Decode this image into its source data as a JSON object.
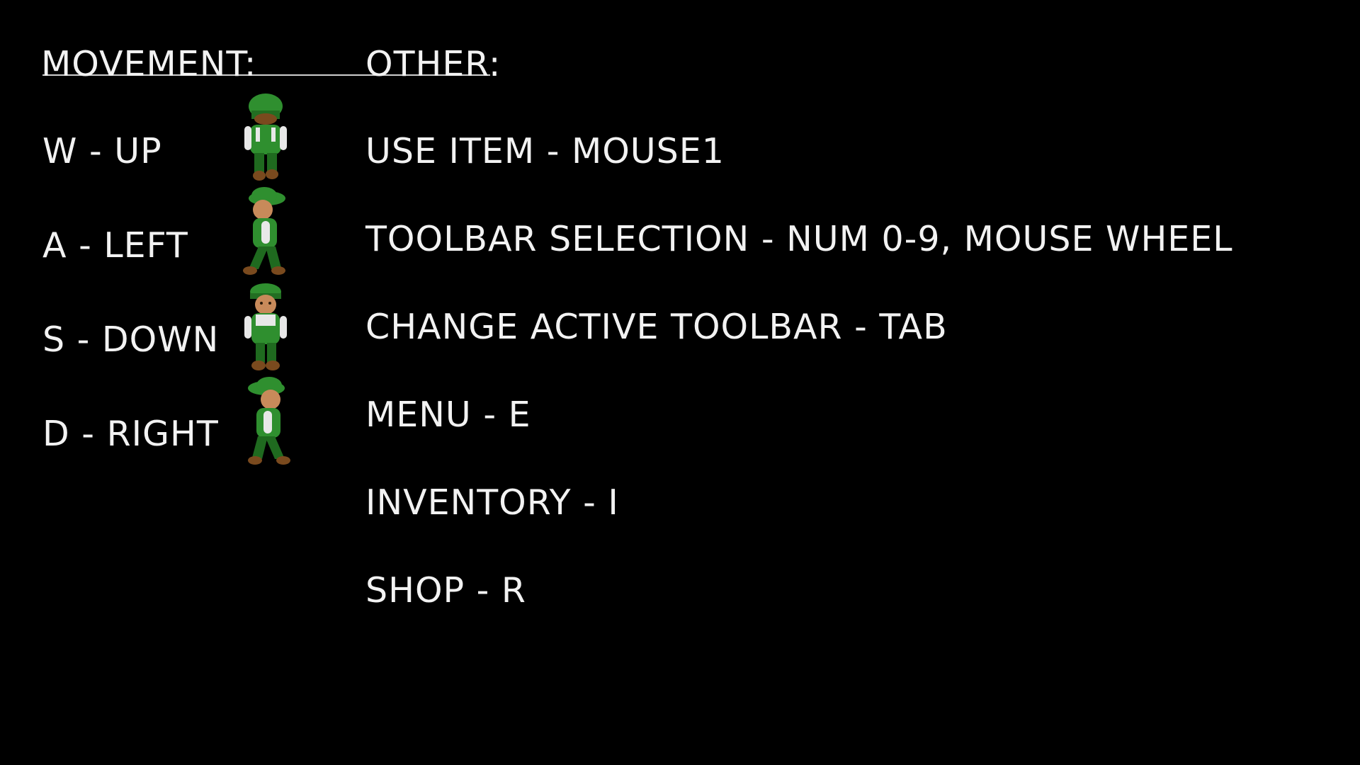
{
  "movement": {
    "heading": "MOVEMENT:",
    "items": [
      {
        "label": "W - UP",
        "sprite": "character-facing-up-icon"
      },
      {
        "label": "A - LEFT",
        "sprite": "character-facing-left-icon"
      },
      {
        "label": "S - DOWN",
        "sprite": "character-facing-down-icon"
      },
      {
        "label": "D - RIGHT",
        "sprite": "character-facing-right-icon"
      }
    ]
  },
  "other": {
    "heading": "OTHER:",
    "items": [
      "USE ITEM - MOUSE1",
      "TOOLBAR SELECTION - NUM 0-9, MOUSE WHEEL",
      "CHANGE ACTIVE TOOLBAR - TAB",
      "MENU - E",
      "INVENTORY - I",
      "SHOP - R"
    ]
  },
  "colors": {
    "background": "#000000",
    "text": "#f2f2f2",
    "character_green": "#2f8f2f",
    "character_dark_green": "#1f6a1f",
    "character_skin": "#c88a5a",
    "character_shirt": "#e8e8e8",
    "character_boots": "#7a4a1e"
  }
}
